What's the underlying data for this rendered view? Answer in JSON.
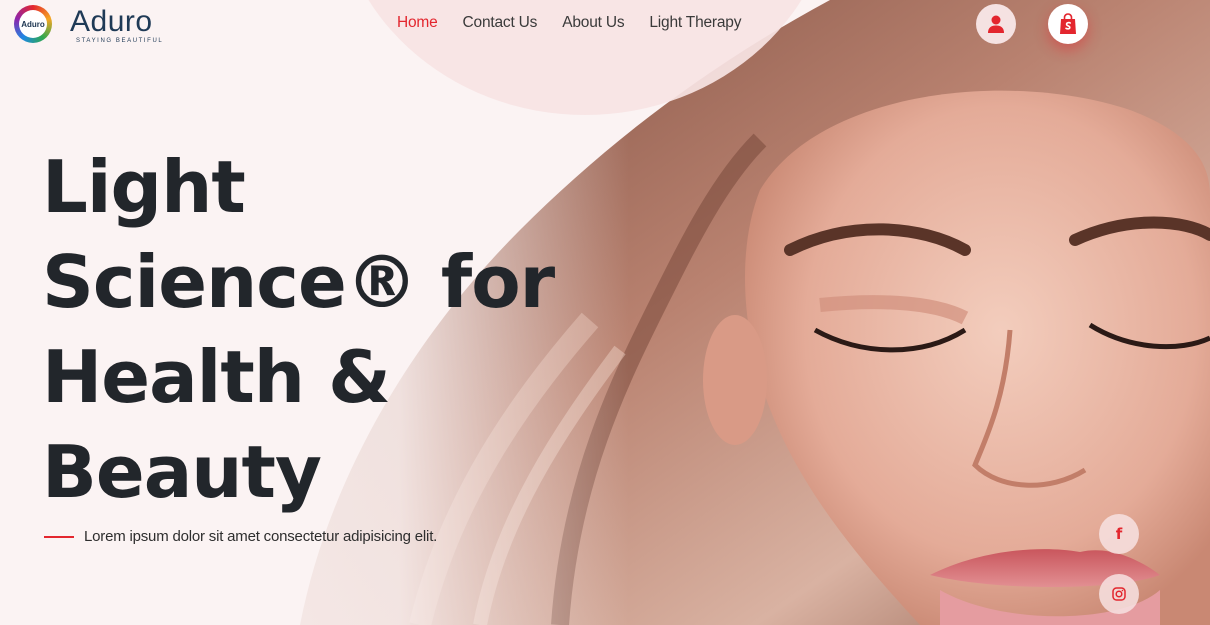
{
  "brand": {
    "name": "Aduro",
    "tagline": "STAYING BEAUTIFUL",
    "badge": "Aduro"
  },
  "nav": [
    {
      "label": "Home",
      "active": true
    },
    {
      "label": "Contact Us",
      "active": false
    },
    {
      "label": "About Us",
      "active": false
    },
    {
      "label": "Light Therapy",
      "active": false
    }
  ],
  "header_icons": {
    "account": "user-icon",
    "cart": "shopping-bag-icon"
  },
  "hero": {
    "headline_lines": [
      "Light",
      "Science® for",
      "Health &",
      "Beauty"
    ],
    "subtitle": "Lorem ipsum dolor sit amet consectetur adipisicing elit."
  },
  "social": [
    {
      "name": "facebook-icon",
      "glyph": "f"
    },
    {
      "name": "instagram-icon"
    }
  ],
  "colors": {
    "accent": "#e3262e",
    "text": "#22262b",
    "background": "#fbf3f3"
  }
}
